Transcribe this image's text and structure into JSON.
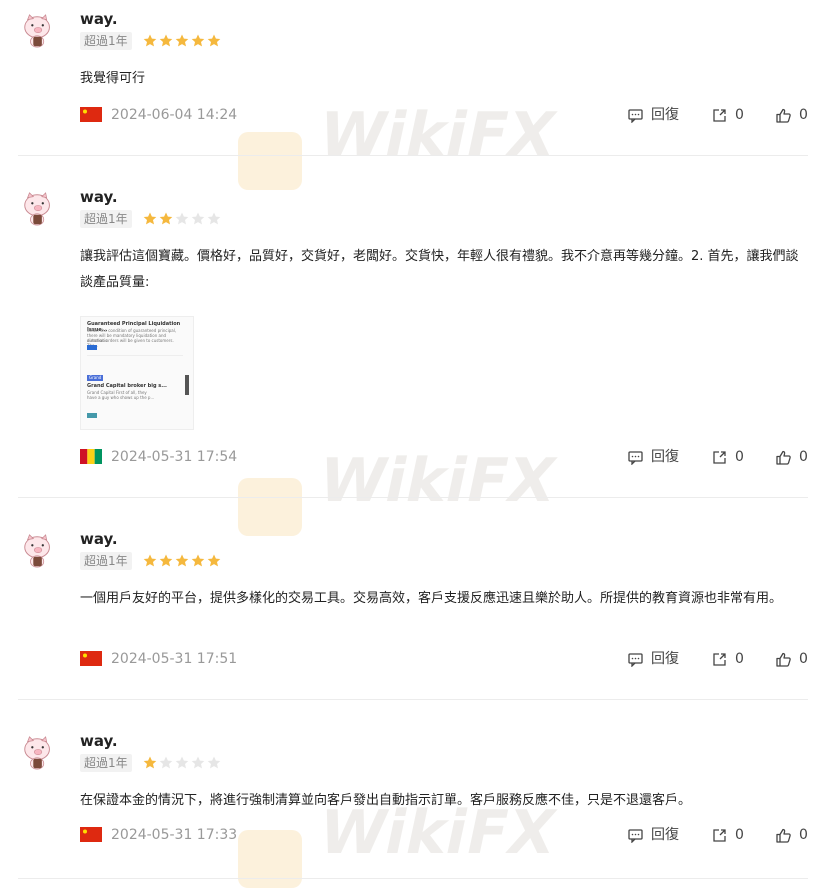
{
  "watermark": "WikiFX",
  "reviews": [
    {
      "username": "way.",
      "age_tag": "超過1年",
      "rating": 5,
      "text": "我覺得可行",
      "flag": "cn",
      "date": "2024-06-04 14:24",
      "reply_label": "回復",
      "share_count": "0",
      "like_count": "0"
    },
    {
      "username": "way.",
      "age_tag": "超過1年",
      "rating": 2,
      "text": "讓我評估這個寶藏。價格好，品質好，交貨好，老闆好。交貨快，年輕人很有禮貌。我不介意再等幾分鐘。2. 首先，讓我們談談產品質量:",
      "flag": "gn",
      "date": "2024-05-31 17:54",
      "reply_label": "回復",
      "share_count": "0",
      "like_count": "0",
      "thumbnail": {
        "line1": "Guaranteed Principal Liquidation Issue...",
        "line2": "Under the condition of guaranteed principal,",
        "line3": "there will be mandatory liquidation and automatic",
        "line4": "direction orders will be given to customers. The...",
        "tag": "Grand",
        "line5": "Grand Capital broker big s...",
        "line6": "Grand Capital First of all, they",
        "line7": "have a guy who shows up the p..."
      }
    },
    {
      "username": "way.",
      "age_tag": "超過1年",
      "rating": 5,
      "text": "一個用戶友好的平台，提供多樣化的交易工具。交易高效，客戶支援反應迅速且樂於助人。所提供的教育資源也非常有用。",
      "flag": "cn",
      "date": "2024-05-31 17:51",
      "reply_label": "回復",
      "share_count": "0",
      "like_count": "0"
    },
    {
      "username": "way.",
      "age_tag": "超過1年",
      "rating": 1,
      "text": "在保證本金的情況下，將進行強制清算並向客戶發出自動指示訂單。客戶服務反應不佳，只是不退還客戶。",
      "flag": "cn",
      "date": "2024-05-31 17:33",
      "reply_label": "回復",
      "share_count": "0",
      "like_count": "0"
    }
  ],
  "colors": {
    "star_on": "#f5b83d",
    "star_off": "#e6e6e6",
    "date": "#999999",
    "cn_red": "#de2910"
  }
}
